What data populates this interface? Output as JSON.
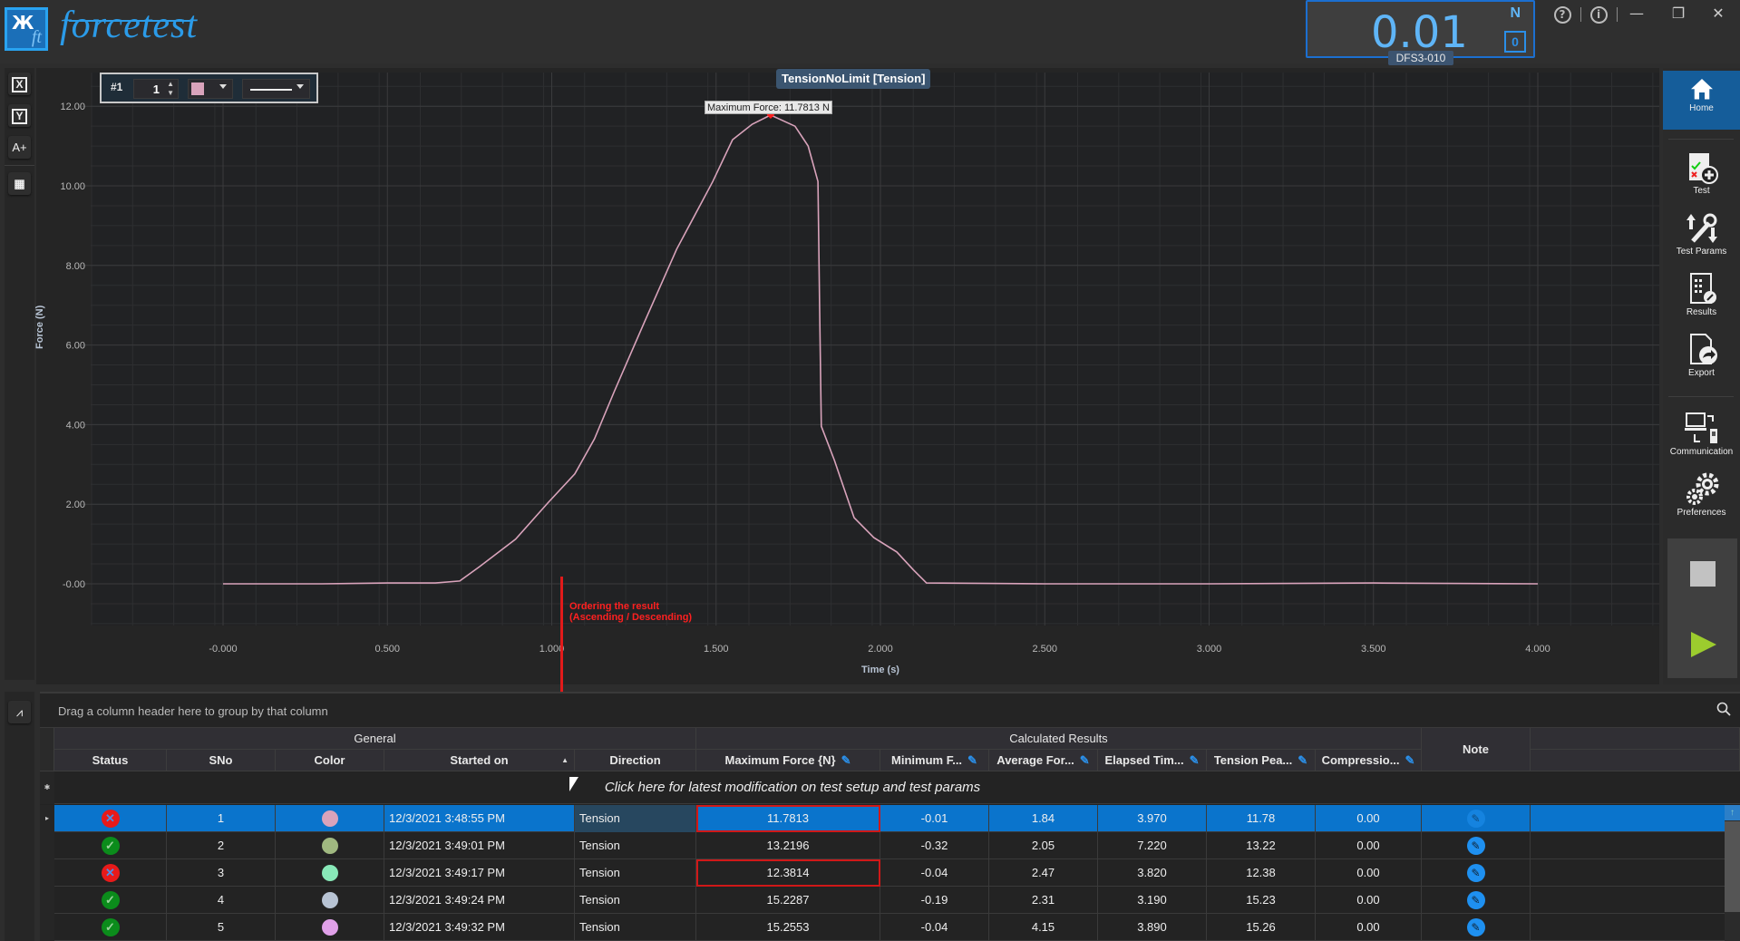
{
  "app": {
    "brand": "forcetest",
    "logo_text_top": "Ж",
    "logo_text_bottom": "ft"
  },
  "readout": {
    "value": "0.01",
    "unit": "N",
    "zero_label": "0",
    "device": "DFS3-010"
  },
  "window_controls": {
    "help": "?",
    "info": "i",
    "minimize": "—",
    "restore": "❐",
    "close": "✕"
  },
  "left_tools": [
    {
      "name": "x-axis-tool",
      "label": "X"
    },
    {
      "name": "y-axis-tool",
      "label": "Y"
    },
    {
      "name": "add-annotation-tool",
      "label": "A+"
    },
    {
      "name": "table-tool",
      "label": "▦"
    }
  ],
  "series_toolbar": {
    "index_label": "#1",
    "spinner_value": "1",
    "color": "#d9a3bb",
    "line_style": "solid"
  },
  "annotation": {
    "line1": "Ordering the result",
    "line2": "(Ascending / Descending)"
  },
  "chart_data": {
    "type": "line",
    "title": "TensionNoLimit [Tension]",
    "xlabel": "Time (s)",
    "ylabel": "Force (N)",
    "xlim": [
      -0.4,
      4.4
    ],
    "ylim": [
      -1.1,
      12.6
    ],
    "x_ticks": [
      "-0.000",
      "0.500",
      "1.000",
      "1.500",
      "2.000",
      "2.500",
      "3.000",
      "3.500",
      "4.000"
    ],
    "x_tick_values": [
      0,
      0.5,
      1.0,
      1.5,
      2.0,
      2.5,
      3.0,
      3.5,
      4.0
    ],
    "y_ticks": [
      "-0.00",
      "2.00",
      "4.00",
      "6.00",
      "8.00",
      "10.00",
      "12.00"
    ],
    "y_tick_values": [
      0,
      2,
      4,
      6,
      8,
      10,
      12
    ],
    "grid": true,
    "peak_label": "Maximum Force: 11.7813 N",
    "peak": {
      "x": 1.666,
      "y": 11.7813
    },
    "series": [
      {
        "name": "#1",
        "color": "#d9a3bb",
        "x": [
          0.0,
          0.3,
          0.5,
          0.646,
          0.72,
          0.78,
          0.89,
          0.99,
          1.07,
          1.13,
          1.19,
          1.28,
          1.38,
          1.49,
          1.55,
          1.61,
          1.666,
          1.74,
          1.78,
          1.81,
          1.815,
          1.82,
          1.86,
          1.88,
          1.92,
          1.98,
          2.05,
          2.1,
          2.14,
          2.5,
          3.0,
          3.5,
          4.0
        ],
        "y": [
          0.0,
          0.0,
          0.02,
          0.02,
          0.07,
          0.43,
          1.12,
          2.05,
          2.76,
          3.64,
          4.83,
          6.54,
          8.41,
          10.11,
          11.16,
          11.55,
          11.78,
          11.5,
          11.0,
          10.11,
          7.0,
          3.96,
          3.1,
          2.62,
          1.66,
          1.16,
          0.8,
          0.35,
          0.02,
          0.0,
          0.0,
          0.02,
          0.0
        ]
      }
    ]
  },
  "right_nav": {
    "items": [
      {
        "label": "Home"
      },
      {
        "label": "Test"
      },
      {
        "label": "Test Params"
      },
      {
        "label": "Results"
      },
      {
        "label": "Export"
      },
      {
        "label": "Communication"
      },
      {
        "label": "Preferences"
      }
    ]
  },
  "grid": {
    "group_hint": "Drag a column header here to group by that column",
    "group_general": "General",
    "group_calc": "Calculated Results",
    "note_header": "Note",
    "columns": [
      "Status",
      "SNo",
      "Color",
      "Started on",
      "Direction",
      "Maximum Force {N}",
      "Minimum F...",
      "Average For...",
      "Elapsed Tim...",
      "Tension Pea...",
      "Compressio..."
    ],
    "new_row_hint": "Click here for latest modification on test setup and test params",
    "rows": [
      {
        "status": "fail",
        "sno": "1",
        "color": "#d9a3bb",
        "started": "12/3/2021 3:48:55 PM",
        "direction": "Tension",
        "max_force": "11.7813",
        "min_force": "-0.01",
        "avg_force": "1.84",
        "elapsed": "3.970",
        "tension_peak": "11.78",
        "compression": "0.00",
        "selected": true,
        "flagged": true
      },
      {
        "status": "pass",
        "sno": "2",
        "color": "#a0b880",
        "started": "12/3/2021 3:49:01 PM",
        "direction": "Tension",
        "max_force": "13.2196",
        "min_force": "-0.32",
        "avg_force": "2.05",
        "elapsed": "7.220",
        "tension_peak": "13.22",
        "compression": "0.00",
        "selected": false,
        "flagged": false
      },
      {
        "status": "fail",
        "sno": "3",
        "color": "#88e8b8",
        "started": "12/3/2021 3:49:17 PM",
        "direction": "Tension",
        "max_force": "12.3814",
        "min_force": "-0.04",
        "avg_force": "2.47",
        "elapsed": "3.820",
        "tension_peak": "12.38",
        "compression": "0.00",
        "selected": false,
        "flagged": true
      },
      {
        "status": "pass",
        "sno": "4",
        "color": "#b8c4d4",
        "started": "12/3/2021 3:49:24 PM",
        "direction": "Tension",
        "max_force": "15.2287",
        "min_force": "-0.19",
        "avg_force": "2.31",
        "elapsed": "3.190",
        "tension_peak": "15.23",
        "compression": "0.00",
        "selected": false,
        "flagged": false
      },
      {
        "status": "pass",
        "sno": "5",
        "color": "#e0a0e8",
        "started": "12/3/2021 3:49:32 PM",
        "direction": "Tension",
        "max_force": "15.2553",
        "min_force": "-0.04",
        "avg_force": "4.15",
        "elapsed": "3.890",
        "tension_peak": "15.26",
        "compression": "0.00",
        "selected": false,
        "flagged": false
      }
    ]
  }
}
